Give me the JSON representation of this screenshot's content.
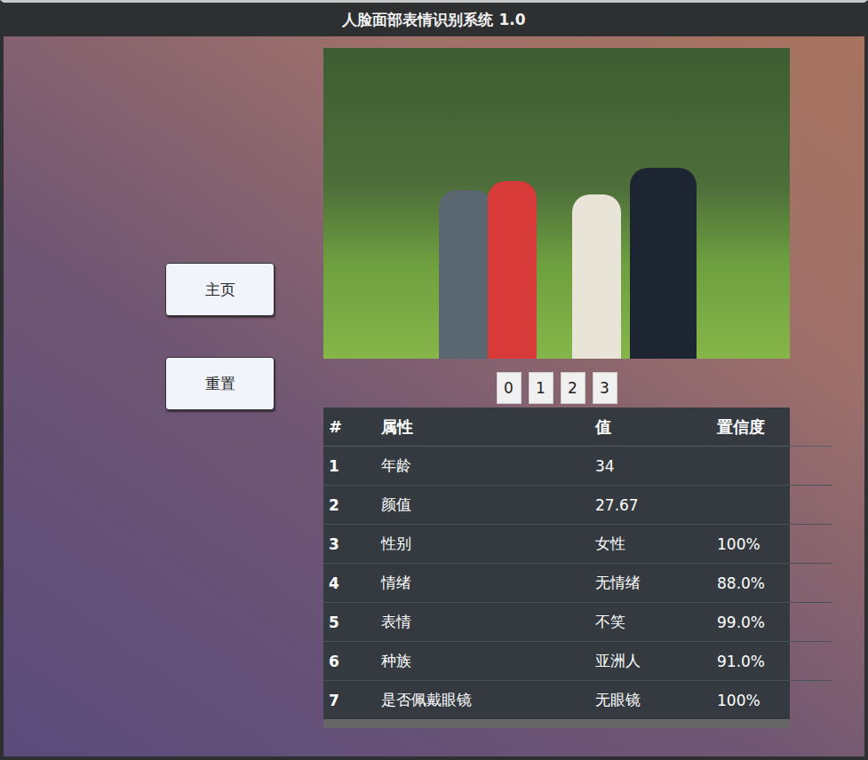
{
  "window": {
    "title": "人脸面部表情识别系统 1.0"
  },
  "nav": [
    "主页",
    "重置"
  ],
  "face_tabs": [
    "0",
    "1",
    "2",
    "3"
  ],
  "table": {
    "columns": [
      "#",
      "属性",
      "值",
      "置信度"
    ],
    "rows": [
      [
        "1",
        "年龄",
        "34",
        ""
      ],
      [
        "2",
        "颜值",
        "27.67",
        ""
      ],
      [
        "3",
        "性别",
        "女性",
        "100%"
      ],
      [
        "4",
        "情绪",
        "无情绪",
        "88.0%"
      ],
      [
        "5",
        "表情",
        "不笑",
        "99.0%"
      ],
      [
        "6",
        "种族",
        "亚洲人",
        "91.0%"
      ],
      [
        "7",
        "是否佩戴眼镜",
        "无眼镜",
        "100%"
      ]
    ]
  }
}
